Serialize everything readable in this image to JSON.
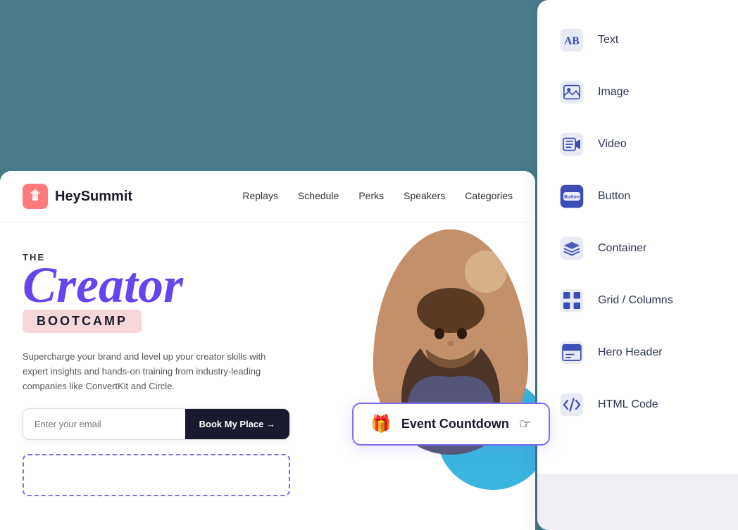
{
  "background": {
    "color": "#4a7c8a"
  },
  "website_preview": {
    "nav": {
      "logo_text": "HeySummit",
      "links": [
        "Replays",
        "Schedule",
        "Perks",
        "Speakers",
        "Categories"
      ]
    },
    "hero": {
      "title_the": "THE",
      "title_creator": "Creator",
      "title_bootcamp": "BOOTCAMP",
      "description": "Supercharge your brand and level up your creator skills with expert insights and hands-on training from industry-leading companies like ConvertKit and Circle.",
      "email_placeholder": "Enter your email",
      "book_button": "Book My Place →"
    },
    "event_countdown": {
      "label": "Event Countdown",
      "icon": "🎁"
    }
  },
  "component_panel": {
    "items": [
      {
        "name": "Text",
        "icon_type": "text"
      },
      {
        "name": "Image",
        "icon_type": "image"
      },
      {
        "name": "Video",
        "icon_type": "video"
      },
      {
        "name": "Button",
        "icon_type": "button"
      },
      {
        "name": "Container",
        "icon_type": "container"
      },
      {
        "name": "Grid / Columns",
        "icon_type": "grid"
      },
      {
        "name": "Hero Header",
        "icon_type": "hero"
      },
      {
        "name": "HTML Code",
        "icon_type": "html"
      }
    ]
  }
}
